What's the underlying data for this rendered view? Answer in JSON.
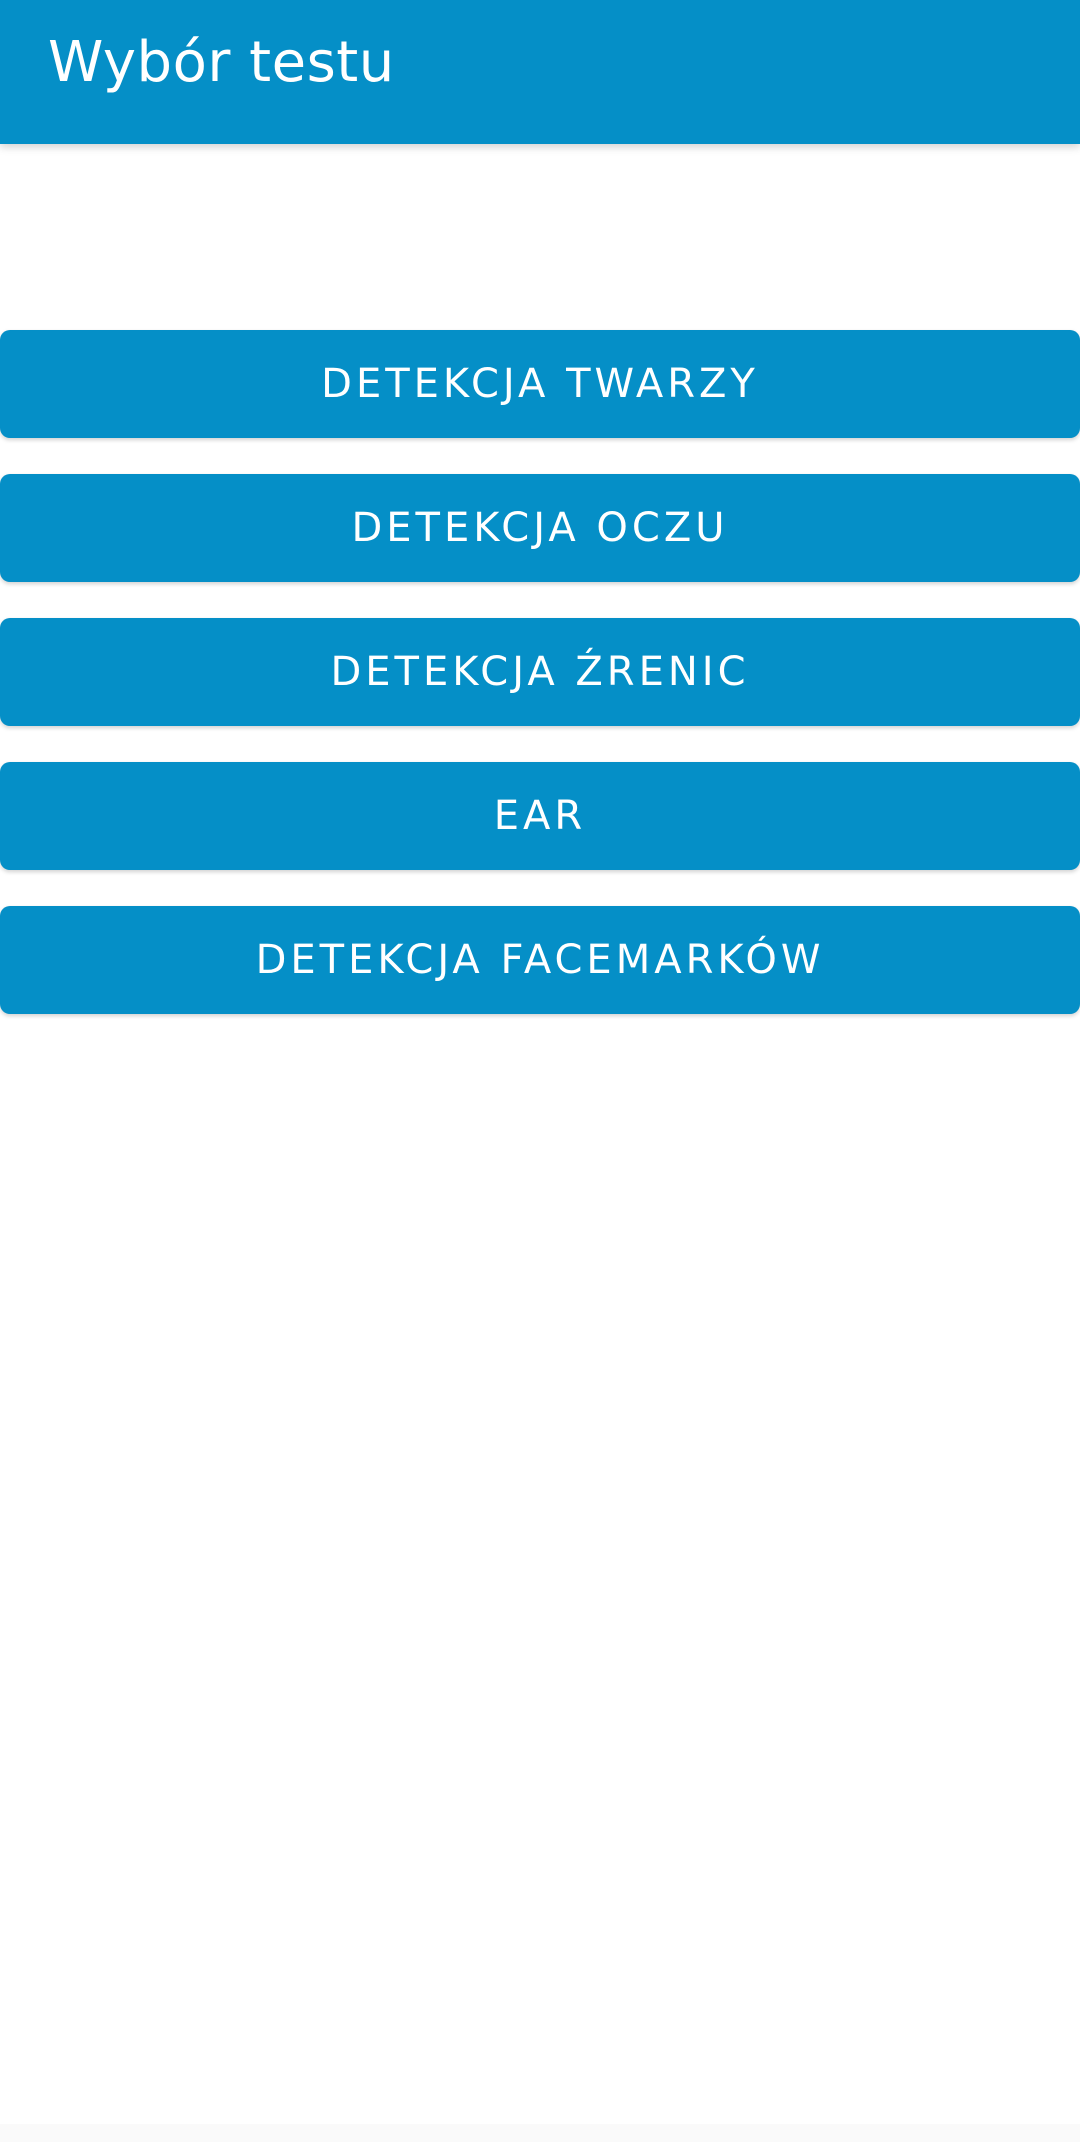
{
  "app_bar": {
    "title": "Wybór testu"
  },
  "buttons": [
    {
      "label": "DETEKCJA TWARZY"
    },
    {
      "label": "DETEKCJA OCZU"
    },
    {
      "label": "DETEKCJA ŹRENIC"
    },
    {
      "label": "EAR"
    },
    {
      "label": "DETEKCJA FACEMARKÓW"
    }
  ],
  "colors": {
    "primary": "#058fc7",
    "on_primary": "#ffffff",
    "background": "#ffffff"
  }
}
